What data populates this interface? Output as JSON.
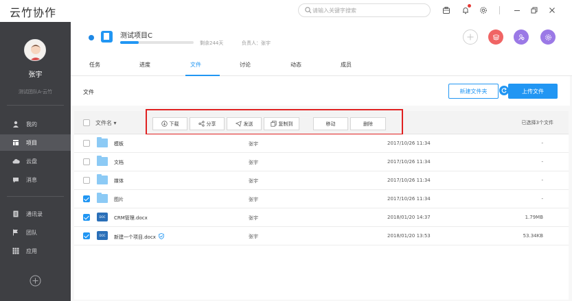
{
  "app": {
    "title": "云竹协作"
  },
  "search": {
    "placeholder": "请输入关键字搜索"
  },
  "sidebar": {
    "user_name": "张宇",
    "team_name": "测试团队A-云竹",
    "items": [
      {
        "label": "我的",
        "icon": "user-icon",
        "active": false
      },
      {
        "label": "项目",
        "icon": "project-icon",
        "active": true
      },
      {
        "label": "云盘",
        "icon": "cloud-icon",
        "active": false
      },
      {
        "label": "消息",
        "icon": "message-icon",
        "active": false
      },
      {
        "label": "通讯录",
        "icon": "contacts-icon",
        "active": false
      },
      {
        "label": "团队",
        "icon": "flag-icon",
        "active": false
      },
      {
        "label": "应用",
        "icon": "apps-icon",
        "active": false
      }
    ]
  },
  "project": {
    "name": "测试项目C",
    "progress": 0.25,
    "remaining": "剩余244天",
    "owner": "负责人：张宇"
  },
  "tabs": [
    "任务",
    "进度",
    "文件",
    "讨论",
    "动态",
    "成员"
  ],
  "active_tab": "文件",
  "breadcrumb": "文件",
  "buttons": {
    "new_folder": "新建文件夹",
    "upload": "上传文件"
  },
  "list_header": {
    "col_name": "文件名 ▾",
    "selected": "已选择3个文件",
    "actions": [
      "下载",
      "分享",
      "发送",
      "复制到",
      "移动",
      "删除"
    ]
  },
  "files": [
    {
      "name": "模板",
      "type": "folder",
      "owner": "张宇",
      "date": "2017/10/26 11:34",
      "size": "-",
      "checked": false
    },
    {
      "name": "文档",
      "type": "folder",
      "owner": "张宇",
      "date": "2017/10/26 11:34",
      "size": "-",
      "checked": false
    },
    {
      "name": "媒体",
      "type": "folder",
      "owner": "张宇",
      "date": "2017/10/26 11:34",
      "size": "-",
      "checked": false
    },
    {
      "name": "图片",
      "type": "folder",
      "owner": "张宇",
      "date": "2017/10/26 11:34",
      "size": "-",
      "checked": true
    },
    {
      "name": "CRM管理.docx",
      "type": "doc",
      "owner": "张宇",
      "date": "2018/01/20 14:37",
      "size": "1.79MB",
      "checked": true
    },
    {
      "name": "新建一个项目.docx",
      "type": "doc",
      "owner": "张宇",
      "date": "2018/01/20 13:53",
      "size": "53.34KB",
      "checked": true,
      "shield": true
    }
  ],
  "colors": {
    "accent": "#2196f3",
    "sidebar": "#3e3f43",
    "highlight_box": "#e02020"
  }
}
